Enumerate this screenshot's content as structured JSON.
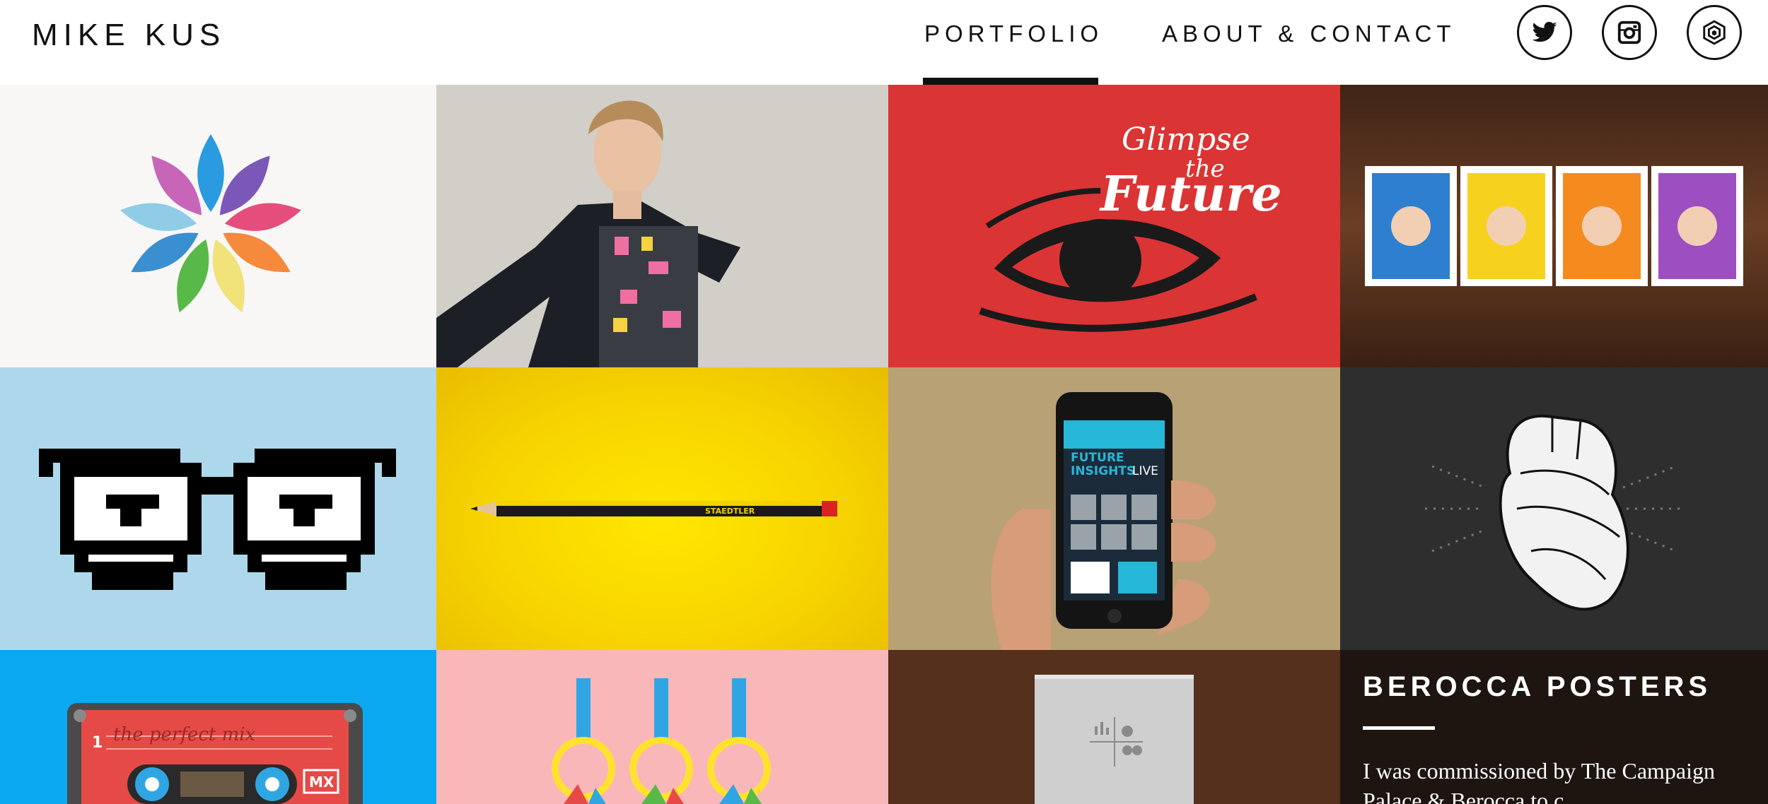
{
  "site": {
    "logo": "MIKE KUS"
  },
  "nav": {
    "portfolio": "PORTFOLIO",
    "about": "ABOUT & CONTACT"
  },
  "social": [
    {
      "name": "twitter-icon"
    },
    {
      "name": "instagram-icon"
    },
    {
      "name": "dribbble-icon"
    }
  ],
  "tiles": {
    "eye_text_1": "Glimpse",
    "eye_text_2": "the",
    "eye_text_3": "Future",
    "phone_title_1": "FUTURE",
    "phone_title_2": "INSIGHTS",
    "phone_title_3": "LIVE",
    "cassette_label": "the perfect mix",
    "cassette_side": "1",
    "cassette_mx": "MX",
    "pencil_brand": "STAEDTLER"
  },
  "info": {
    "title": "BEROCCA POSTERS",
    "text": "I was commissioned by The Campaign Palace & Berocca to c..."
  },
  "colors": {
    "accent": "#111111",
    "red": "#db3434",
    "sky": "#add8ec",
    "yellow": "#f7d400",
    "blue": "#0aa9f2",
    "pink": "#f9b7ba"
  }
}
